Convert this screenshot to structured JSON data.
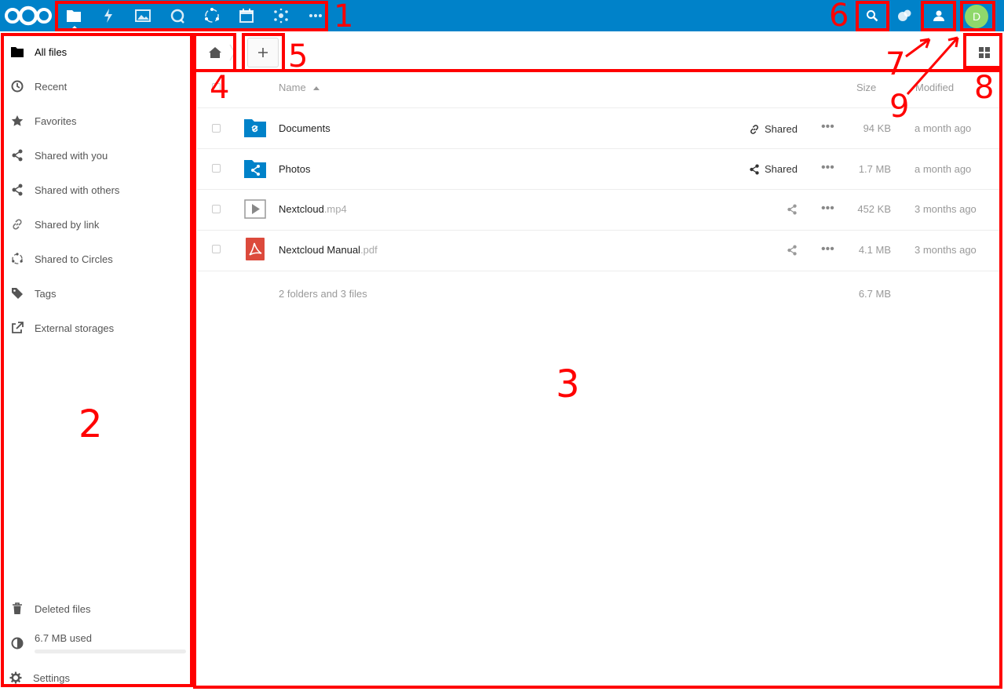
{
  "header": {
    "apps": [
      {
        "name": "Files",
        "icon": "folder-icon"
      },
      {
        "name": "Activity",
        "icon": "lightning-icon"
      },
      {
        "name": "Gallery",
        "icon": "image-icon"
      },
      {
        "name": "Talk",
        "icon": "chat-icon"
      },
      {
        "name": "Circles",
        "icon": "circles-icon"
      },
      {
        "name": "Calendar",
        "icon": "calendar-icon"
      },
      {
        "name": "Social",
        "icon": "social-icon"
      },
      {
        "name": "More apps",
        "icon": "more-icon"
      }
    ],
    "avatar_initial": "D",
    "avatar_color": "#8fd86b",
    "brand_color": "#0082c9"
  },
  "sidebar": {
    "items": [
      {
        "label": "All files",
        "icon": "folder-icon"
      },
      {
        "label": "Recent",
        "icon": "clock-icon"
      },
      {
        "label": "Favorites",
        "icon": "star-icon"
      },
      {
        "label": "Shared with you",
        "icon": "share-icon"
      },
      {
        "label": "Shared with others",
        "icon": "share-icon"
      },
      {
        "label": "Shared by link",
        "icon": "link-icon"
      },
      {
        "label": "Shared to Circles",
        "icon": "circles-icon"
      },
      {
        "label": "Tags",
        "icon": "tag-icon"
      },
      {
        "label": "External storages",
        "icon": "external-icon"
      }
    ],
    "deleted_label": "Deleted files",
    "quota_label": "6.7 MB used",
    "quota_fraction": 0.0,
    "settings_label": "Settings"
  },
  "table": {
    "col_name": "Name",
    "col_size": "Size",
    "col_modified": "Modified",
    "rows": [
      {
        "name": "Documents",
        "ext": "",
        "type": "folder-link",
        "share": "Shared",
        "size": "94 KB",
        "modified": "a month ago"
      },
      {
        "name": "Photos",
        "ext": "",
        "type": "folder-shared",
        "share": "Shared",
        "size": "1.7 MB",
        "modified": "a month ago"
      },
      {
        "name": "Nextcloud",
        "ext": ".mp4",
        "type": "video",
        "share": "",
        "size": "452 KB",
        "modified": "3 months ago"
      },
      {
        "name": "Nextcloud Manual",
        "ext": ".pdf",
        "type": "pdf",
        "share": "",
        "size": "4.1 MB",
        "modified": "3 months ago"
      }
    ],
    "summary_label": "2 folders and 3 files",
    "summary_size": "6.7 MB"
  },
  "annotations": [
    "1",
    "2",
    "3",
    "4",
    "5",
    "6",
    "7",
    "8",
    "9"
  ]
}
